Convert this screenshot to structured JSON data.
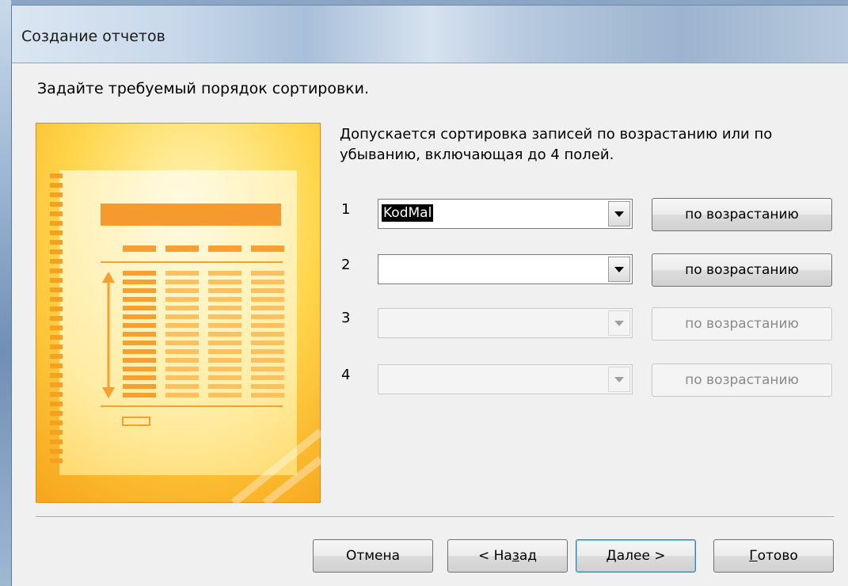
{
  "window": {
    "title": "Создание отчетов"
  },
  "heading": "Задайте требуемый порядок сортировки.",
  "description": "Допускается сортировка записей по возрастанию или по убыванию, включающая до 4 полей.",
  "sort_rows": [
    {
      "number": "1",
      "field_value": "KodMal",
      "order_label": "по возрастанию",
      "enabled": true
    },
    {
      "number": "2",
      "field_value": "",
      "order_label": "по возрастанию",
      "enabled": true
    },
    {
      "number": "3",
      "field_value": "",
      "order_label": "по возрастанию",
      "enabled": false
    },
    {
      "number": "4",
      "field_value": "",
      "order_label": "по возрастанию",
      "enabled": false
    }
  ],
  "buttons": {
    "cancel": "Отмена",
    "back_prefix": "< На",
    "back_accel": "з",
    "back_suffix": "ад",
    "next_accel": "Д",
    "next_suffix": "алее >",
    "finish_accel": "Г",
    "finish_suffix": "отово"
  },
  "colors": {
    "graphic_orange": "#f5a623",
    "graphic_yellow": "#ffe27a",
    "focus_border": "#3c7fb1"
  },
  "icons": {
    "dropdown": "chevron-down-icon"
  }
}
